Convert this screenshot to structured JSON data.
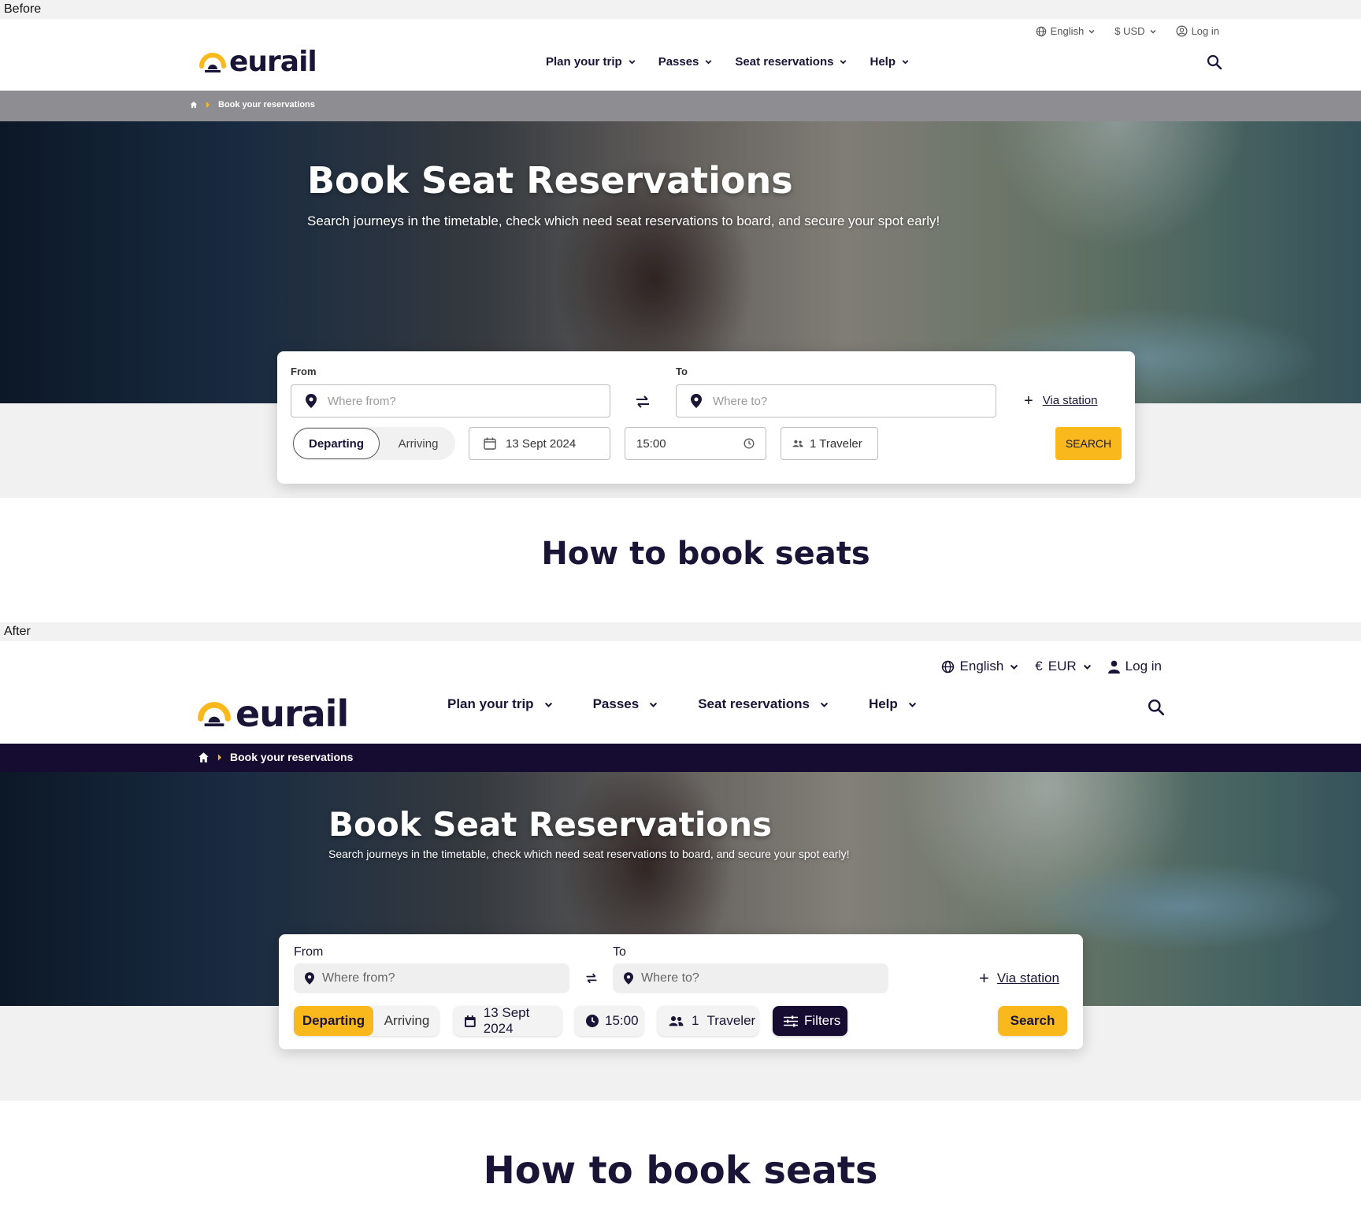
{
  "labels": {
    "before": "Before",
    "after": "After"
  },
  "brand": {
    "name": "eurail",
    "accent": "#f9b91c",
    "navy": "#1a1536"
  },
  "before": {
    "utility": {
      "language": "English",
      "currency": "$ USD",
      "login": "Log in"
    },
    "nav": [
      "Plan your trip",
      "Passes",
      "Seat reservations",
      "Help"
    ],
    "breadcrumb": {
      "current": "Book your reservations"
    },
    "hero": {
      "title": "Book Seat Reservations",
      "subtitle": "Search journeys in the timetable, check which need seat reservations to board, and secure your spot early!"
    },
    "form": {
      "from_label": "From",
      "from_placeholder": "Where from?",
      "to_label": "To",
      "to_placeholder": "Where to?",
      "via": "Via station",
      "departing": "Departing",
      "arriving": "Arriving",
      "date": "13 Sept 2024",
      "time": "15:00",
      "travelers": "1 Traveler",
      "search": "SEARCH"
    },
    "section_title": "How to book seats"
  },
  "after": {
    "utility": {
      "language": "English",
      "currency": "EUR",
      "currency_symbol": "€",
      "login": "Log in"
    },
    "nav": [
      "Plan your trip",
      "Passes",
      "Seat reservations",
      "Help"
    ],
    "breadcrumb": {
      "current": "Book your reservations"
    },
    "hero": {
      "title": "Book Seat Reservations",
      "subtitle": "Search journeys in the timetable, check which need seat reservations to board, and secure your spot early!"
    },
    "form": {
      "from_label": "From",
      "from_placeholder": "Where from?",
      "to_label": "To",
      "to_placeholder": "Where to?",
      "via": "Via station",
      "departing": "Departing",
      "arriving": "Arriving",
      "date": "13 Sept 2024",
      "time": "15:00",
      "travelers_count": "1",
      "travelers_label": "Traveler",
      "filters": "Filters",
      "search": "Search"
    },
    "section_title": "How to book seats"
  }
}
